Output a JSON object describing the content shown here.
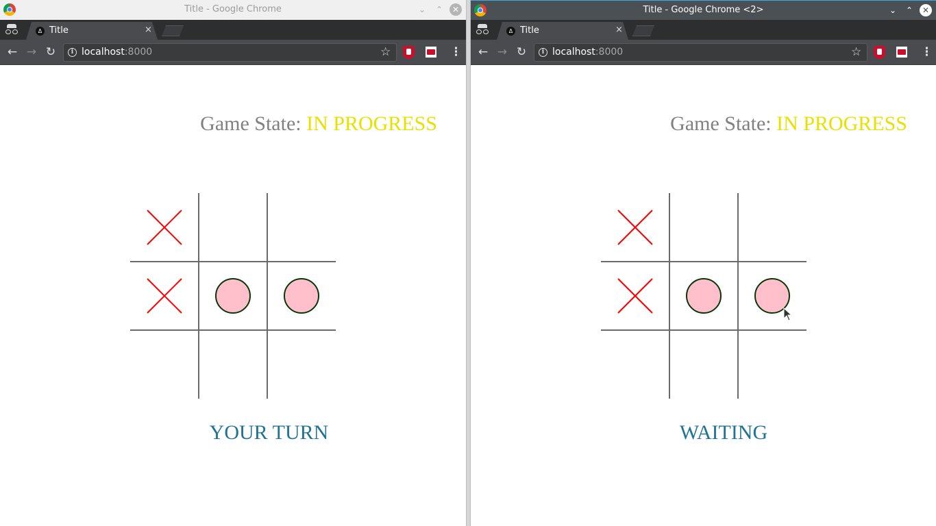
{
  "windows": [
    {
      "title": "Title - Google Chrome",
      "tab_title": "Title",
      "tab_close": "×",
      "url_host": "localhost",
      "url_port": ":8000",
      "game_state_label": "Game State:",
      "game_state_value": "IN PROGRESS",
      "turn_status": "YOUR TURN",
      "board": [
        "X",
        "",
        "",
        "X",
        "O",
        "O",
        "",
        "",
        ""
      ]
    },
    {
      "title": "Title - Google Chrome <2>",
      "tab_title": "Title",
      "tab_close": "×",
      "url_host": "localhost",
      "url_port": ":8000",
      "game_state_label": "Game State:",
      "game_state_value": "IN PROGRESS",
      "turn_status": "WAITING",
      "board": [
        "X",
        "",
        "",
        "X",
        "O",
        "O",
        "",
        "",
        ""
      ]
    }
  ],
  "colors": {
    "x_mark": "#ff0000",
    "o_fill": "#ffc0cb",
    "o_stroke": "#063806",
    "game_state_value": "#e8e000",
    "turn_status": "#1f7394"
  },
  "icons": {
    "back": "back-arrow-icon",
    "forward": "forward-arrow-icon",
    "reload": "reload-icon",
    "info": "info-icon",
    "bookmark": "star-icon",
    "menu": "kebab-menu-icon"
  }
}
